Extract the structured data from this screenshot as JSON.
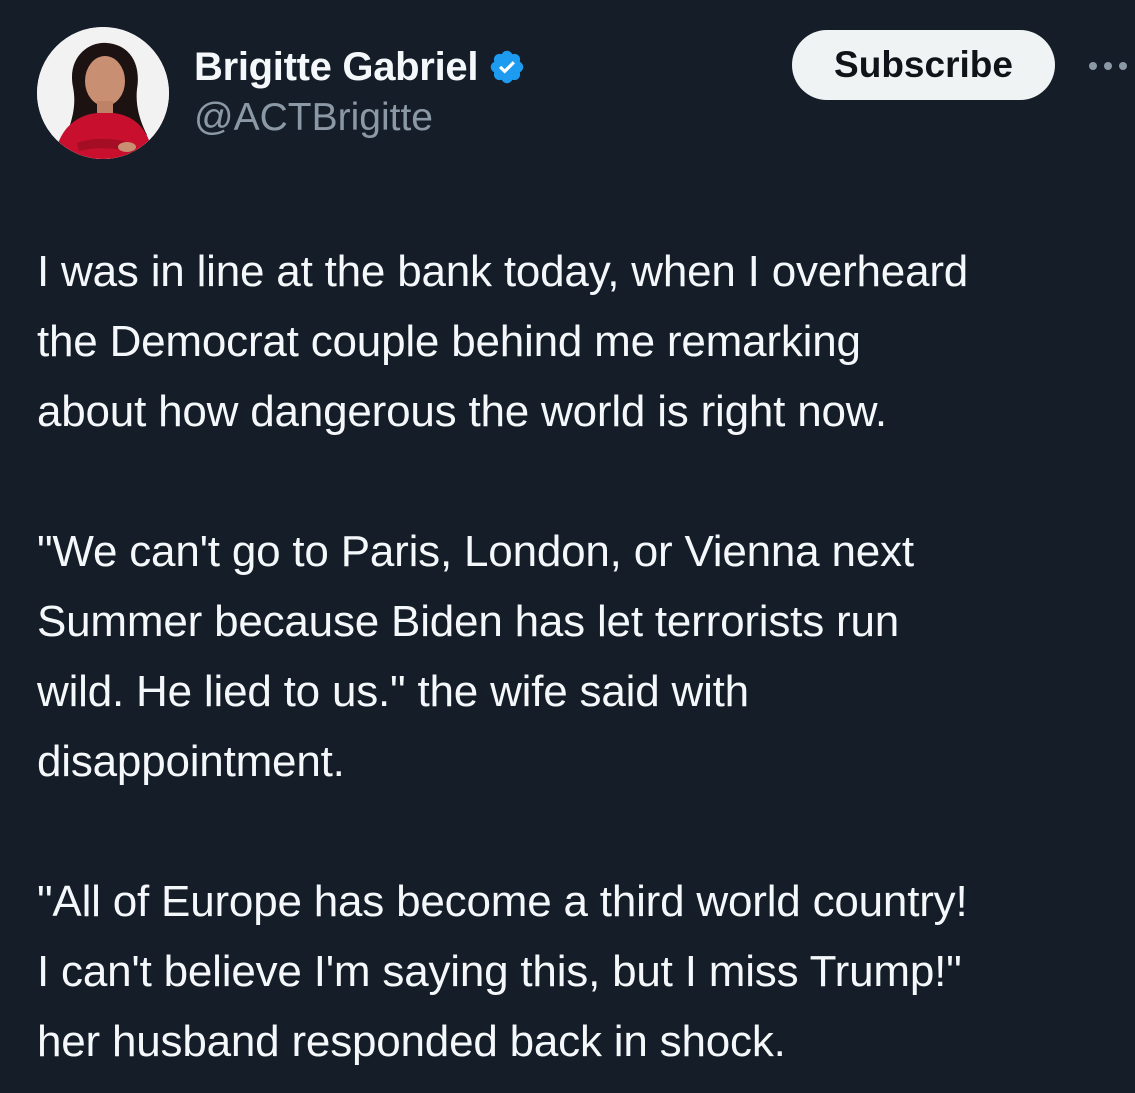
{
  "author": {
    "display_name": "Brigitte Gabriel",
    "handle": "@ACTBrigitte",
    "verified_icon": "verified-badge-icon",
    "avatar": "profile-photo"
  },
  "actions": {
    "subscribe_label": "Subscribe",
    "more_icon": "more-options-icon"
  },
  "post": {
    "paragraphs": [
      "I was in line at the bank today, when I overheard\nthe Democrat couple behind me remarking\nabout how dangerous the world is right now.",
      "\"We can't go to Paris, London, or Vienna next\nSummer because Biden has let terrorists run\nwild. He lied to us.\" the wife said with\ndisappointment.",
      "\"All of Europe has become a third world country!\nI can't believe I'm saying this, but I miss Trump!\"\nher husband responded back in shock."
    ]
  },
  "colors": {
    "background": "#151d28",
    "text_primary": "#f5f8fa",
    "text_secondary": "#8b98a5",
    "verified_blue": "#1d9bf0",
    "button_bg": "#eff3f4",
    "button_text": "#0f1419"
  }
}
